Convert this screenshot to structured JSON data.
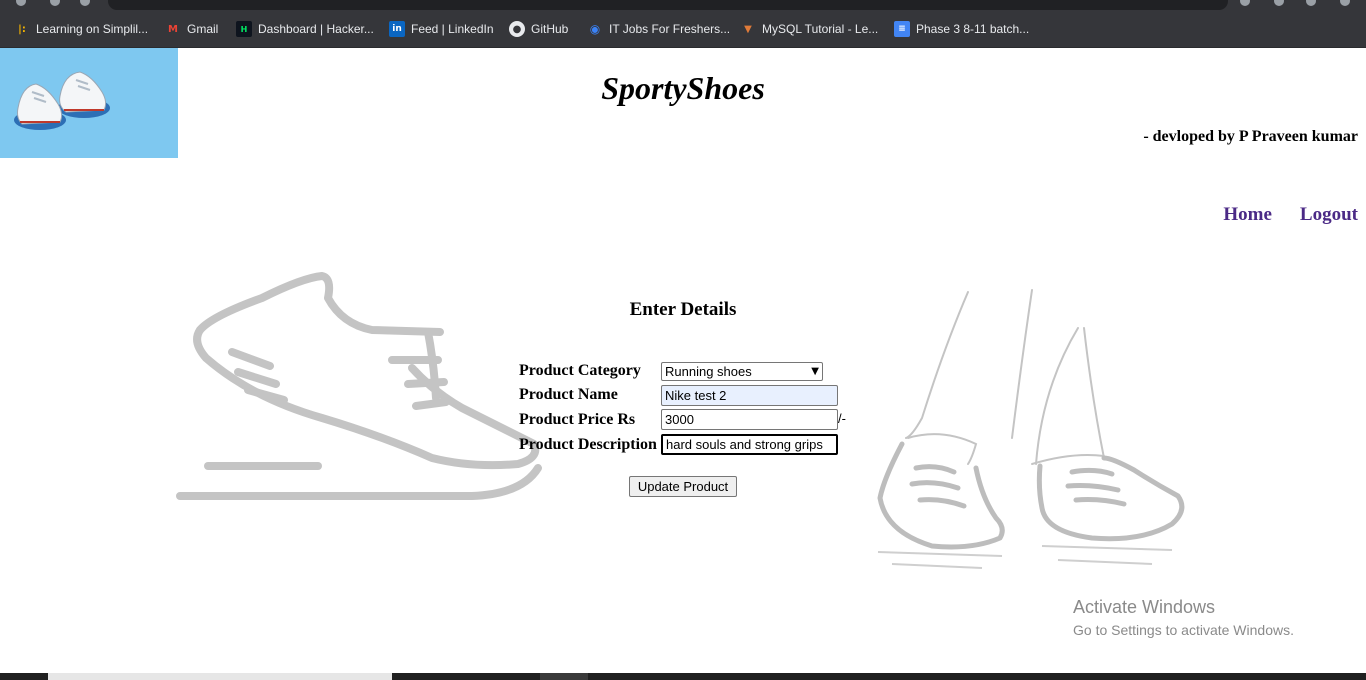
{
  "bookmarks": [
    {
      "label": "Learning on Simplil...",
      "icon": "simplilearn-icon",
      "color": "#f4b400"
    },
    {
      "label": "Gmail",
      "icon": "gmail-icon",
      "color": "#ea4335"
    },
    {
      "label": "Dashboard | Hacker...",
      "icon": "hackerrank-icon",
      "color": "#00ea64"
    },
    {
      "label": "Feed | LinkedIn",
      "icon": "linkedin-icon",
      "color": "#0a66c2"
    },
    {
      "label": "GitHub",
      "icon": "github-icon",
      "color": "#e8eaed"
    },
    {
      "label": "IT Jobs For Freshers...",
      "icon": "jobs-icon",
      "color": "#3b82f6"
    },
    {
      "label": "MySQL Tutorial - Le...",
      "icon": "mysql-icon",
      "color": "#e07b39"
    },
    {
      "label": "Phase 3 8-11 batch...",
      "icon": "docs-icon",
      "color": "#4285f4"
    }
  ],
  "site": {
    "title": "SportyShoes",
    "byline": "- devloped by P Praveen kumar"
  },
  "nav": {
    "home": "Home",
    "logout": "Logout"
  },
  "form": {
    "title": "Enter Details",
    "category_label": "Product Category",
    "category_value": "Running shoes",
    "name_label": "Product Name",
    "name_value": "Nike test 2",
    "price_label": "Product Price Rs",
    "price_value": "3000",
    "price_suffix": "/-",
    "description_label": "Product Description",
    "description_value": "hard souls and strong grips",
    "submit_label": "Update Product"
  },
  "watermark": {
    "line1": "Activate Windows",
    "line2": "Go to Settings to activate Windows."
  },
  "colors": {
    "nav_link": "#4b2a86",
    "logo_bg": "#7ec8f0",
    "chrome_bg": "#35363a"
  }
}
